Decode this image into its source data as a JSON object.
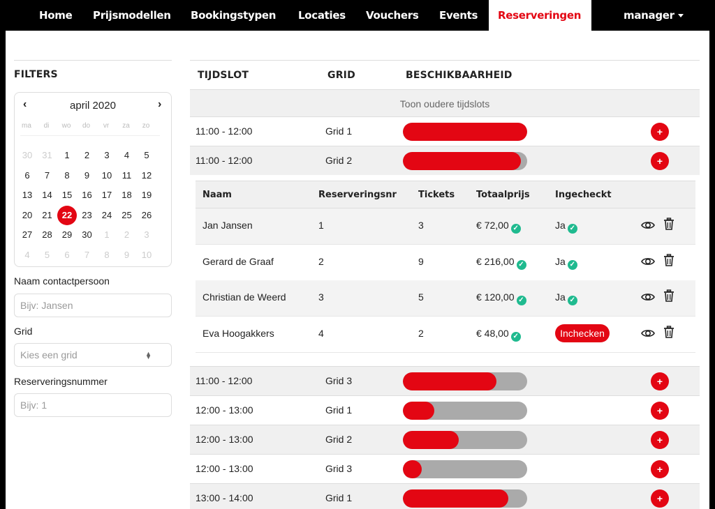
{
  "nav": {
    "items": [
      "Home",
      "Prijsmodellen",
      "Bookingstypen",
      "Locaties",
      "Vouchers",
      "Events",
      "Reserveringen"
    ],
    "active": "Reserveringen",
    "user": "manager"
  },
  "colors": {
    "accent": "#e30613",
    "success": "#1fba8f",
    "bar_empty": "#aaaaaa"
  },
  "filters": {
    "title": "FILTERS",
    "calendar": {
      "month": "april 2020",
      "prev": "‹",
      "next": "›",
      "weekdays": [
        "ma",
        "di",
        "wo",
        "do",
        "vr",
        "za",
        "zo"
      ],
      "selected_day": "22",
      "weeks": [
        [
          "30",
          "31",
          "1",
          "2",
          "3",
          "4",
          "5"
        ],
        [
          "6",
          "7",
          "8",
          "9",
          "10",
          "11",
          "12"
        ],
        [
          "13",
          "14",
          "15",
          "16",
          "17",
          "18",
          "19"
        ],
        [
          "20",
          "21",
          "22",
          "23",
          "24",
          "25",
          "26"
        ],
        [
          "27",
          "28",
          "29",
          "30",
          "1",
          "2",
          "3"
        ],
        [
          "4",
          "5",
          "6",
          "7",
          "8",
          "9",
          "10"
        ]
      ]
    },
    "contact_label": "Naam contactpersoon",
    "contact_placeholder": "Bijv: Jansen",
    "grid_label": "Grid",
    "grid_placeholder": "Kies een grid",
    "resnr_label": "Reserveringsnummer",
    "resnr_placeholder": "Bijv: 1"
  },
  "table": {
    "headers": {
      "slot": "TIJDSLOT",
      "grid": "GRID",
      "availability": "BESCHIKBAARHEID"
    },
    "older_label": "Toon oudere tijdslots",
    "add_label": "+",
    "top_rows": [
      {
        "slot": "11:00 - 12:00",
        "grid": "Grid 1",
        "fill": 1.0
      },
      {
        "slot": "11:00 - 12:00",
        "grid": "Grid 2",
        "fill": 0.95
      }
    ],
    "bottom_rows": [
      {
        "slot": "11:00 - 12:00",
        "grid": "Grid 3",
        "fill": 0.75
      },
      {
        "slot": "12:00 - 13:00",
        "grid": "Grid 1",
        "fill": 0.25
      },
      {
        "slot": "12:00 - 13:00",
        "grid": "Grid 2",
        "fill": 0.45
      },
      {
        "slot": "12:00 - 13:00",
        "grid": "Grid 3",
        "fill": 0.15
      },
      {
        "slot": "13:00 - 14:00",
        "grid": "Grid 1",
        "fill": 0.85
      }
    ]
  },
  "reservations": {
    "headers": {
      "name": "Naam",
      "number": "Reserveringsnr",
      "tickets": "Tickets",
      "total": "Totaalprijs",
      "checked_in": "Ingecheckt"
    },
    "checkin_button": "Inchecken",
    "rows": [
      {
        "name": "Jan Jansen",
        "number": "1",
        "tickets": "3",
        "total": "€ 72,00",
        "checked_in": "Ja"
      },
      {
        "name": "Gerard de Graaf",
        "number": "2",
        "tickets": "9",
        "total": "€ 216,00",
        "checked_in": "Ja"
      },
      {
        "name": "Christian de Weerd",
        "number": "3",
        "tickets": "5",
        "total": "€ 120,00",
        "checked_in": "Ja"
      },
      {
        "name": "Eva Hoogakkers",
        "number": "4",
        "tickets": "2",
        "total": "€ 48,00",
        "checked_in": ""
      }
    ]
  }
}
